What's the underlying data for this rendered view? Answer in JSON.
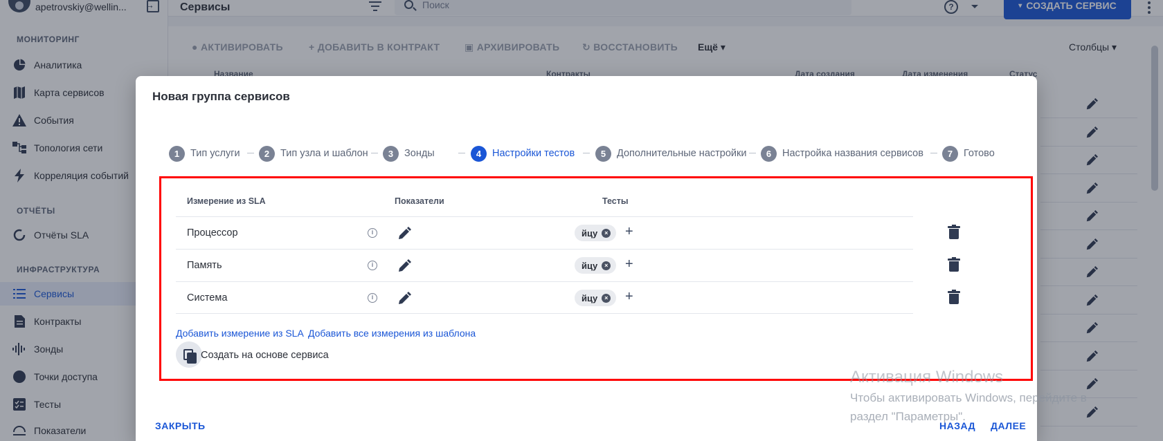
{
  "user": {
    "email": "apetrovskiy@wellin..."
  },
  "sidebar": {
    "sections": [
      {
        "title": "МОНИТОРИНГ",
        "items": [
          {
            "label": "Аналитика",
            "icon": "pie-chart-icon"
          },
          {
            "label": "Карта сервисов",
            "icon": "map-icon"
          },
          {
            "label": "События",
            "icon": "warning-icon"
          },
          {
            "label": "Топология сети",
            "icon": "topology-icon"
          },
          {
            "label": "Корреляция событий",
            "icon": "bolt-icon"
          }
        ]
      },
      {
        "title": "ОТЧЁТЫ",
        "items": [
          {
            "label": "Отчёты SLA",
            "icon": "circle-progress-icon"
          }
        ]
      },
      {
        "title": "ИНФРАСТРУКТУРА",
        "items": [
          {
            "label": "Сервисы",
            "icon": "list-icon"
          },
          {
            "label": "Контракты",
            "icon": "document-icon"
          },
          {
            "label": "Зонды",
            "icon": "signal-icon"
          },
          {
            "label": "Точки доступа",
            "icon": "dot-icon"
          },
          {
            "label": "Тесты",
            "icon": "checklist-icon"
          },
          {
            "label": "Показатели",
            "icon": "gauge-icon"
          }
        ]
      }
    ]
  },
  "topbar": {
    "title": "Сервисы",
    "search_placeholder": "Поиск",
    "create_label": "СОЗДАТЬ СЕРВИС"
  },
  "background": {
    "toolbar": [
      "АКТИВИРОВАТЬ",
      "ДОБАВИТЬ В КОНТРАКТ",
      "АРХИВИРОВАТЬ",
      "ВОССТАНОВИТЬ"
    ],
    "more_label": "Ещё",
    "columns_label": "Столбцы",
    "headers": [
      "Название",
      "Контракты",
      "Дата создания",
      "Дата изменения",
      "Статус"
    ]
  },
  "modal": {
    "title": "Новая группа сервисов",
    "steps": [
      {
        "num": "1",
        "label": "Тип услуги"
      },
      {
        "num": "2",
        "label": "Тип узла и шаблон"
      },
      {
        "num": "3",
        "label": "Зонды"
      },
      {
        "num": "4",
        "label": "Настройки тестов"
      },
      {
        "num": "5",
        "label": "Дополнительные настройки"
      },
      {
        "num": "6",
        "label": "Настройка названия сервисов"
      },
      {
        "num": "7",
        "label": "Готово"
      }
    ],
    "active_step": 4,
    "table": {
      "headers": [
        "Измерение из SLA",
        "Показатели",
        "Тесты"
      ],
      "rows": [
        {
          "name": "Процессор",
          "test": "йцу"
        },
        {
          "name": "Память",
          "test": "йцу"
        },
        {
          "name": "Система",
          "test": "йцу"
        }
      ]
    },
    "add_link": "Добавить измерение из SLA",
    "add_all_link": "Добавить все измерения из шаблона",
    "copy_label": "Создать на основе сервиса",
    "close_label": "ЗАКРЫТЬ",
    "back_label": "НАЗАД",
    "next_label": "ДАЛЕЕ"
  },
  "watermark": {
    "title": "Активация Windows",
    "line1": "Чтобы активировать Windows, перейдите в",
    "line2": "раздел \"Параметры\"."
  }
}
